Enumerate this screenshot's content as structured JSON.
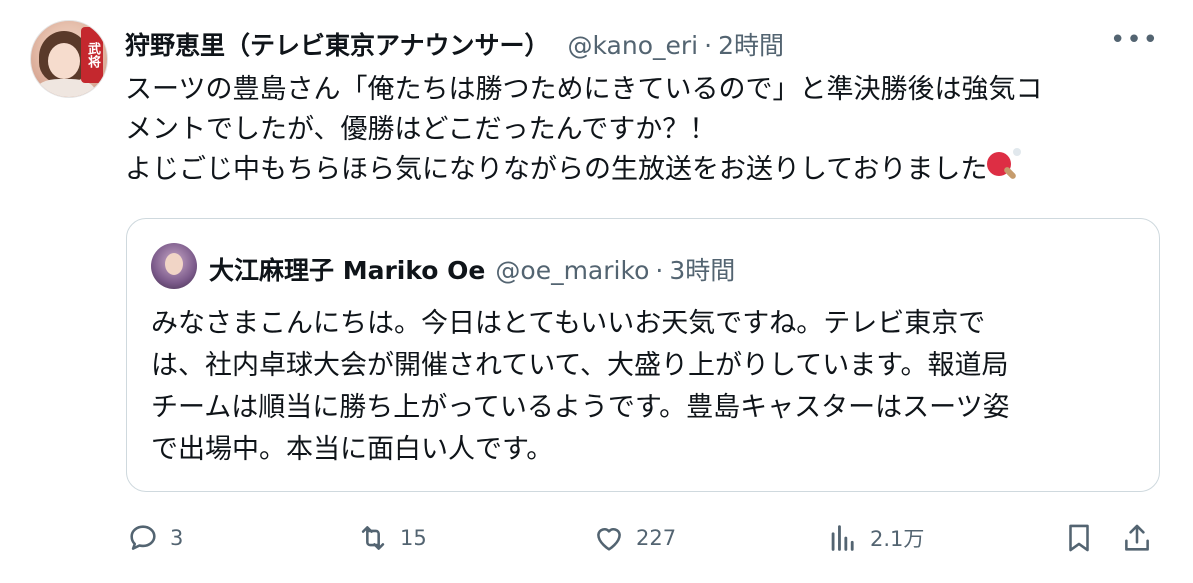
{
  "tweet": {
    "display_name": "狩野恵里（テレビ東京アナウンサー）",
    "handle": "@kano_eri",
    "separator": "·",
    "time": "2時間",
    "avatar_badge": "武将",
    "more_label": "•••",
    "text": "スーツの豊島さん「俺たちは勝つためにきているので」と準決勝後は強気コ\nメントでしたが、優勝はどこだったんですか？！\nよじごじ中もちらほら気になりながらの生放送をお送りしておりました",
    "emoji": "ping-pong-emoji"
  },
  "quoted": {
    "display_name": "大江麻理子 Mariko Oe",
    "handle": "@oe_mariko",
    "separator": "·",
    "time": "3時間",
    "text": "みなさまこんにちは。今日はとてもいいお天気ですね。テレビ東京で\nは、社内卓球大会が開催されていて、大盛り上がりしています。報道局\nチームは順当に勝ち上がっているようです。豊島キャスターはスーツ姿\nで出場中。本当に面白い人です。"
  },
  "actions": {
    "reply_count": "3",
    "retweet_count": "15",
    "like_count": "227",
    "views_count": "2.1万"
  },
  "icons": {
    "reply": "reply-icon",
    "retweet": "retweet-icon",
    "like": "heart-icon",
    "views": "views-icon",
    "bookmark": "bookmark-icon",
    "share": "share-icon",
    "more": "more-icon"
  },
  "colors": {
    "text_primary": "#0f1419",
    "text_secondary": "#536471",
    "border": "#cfd9de"
  }
}
